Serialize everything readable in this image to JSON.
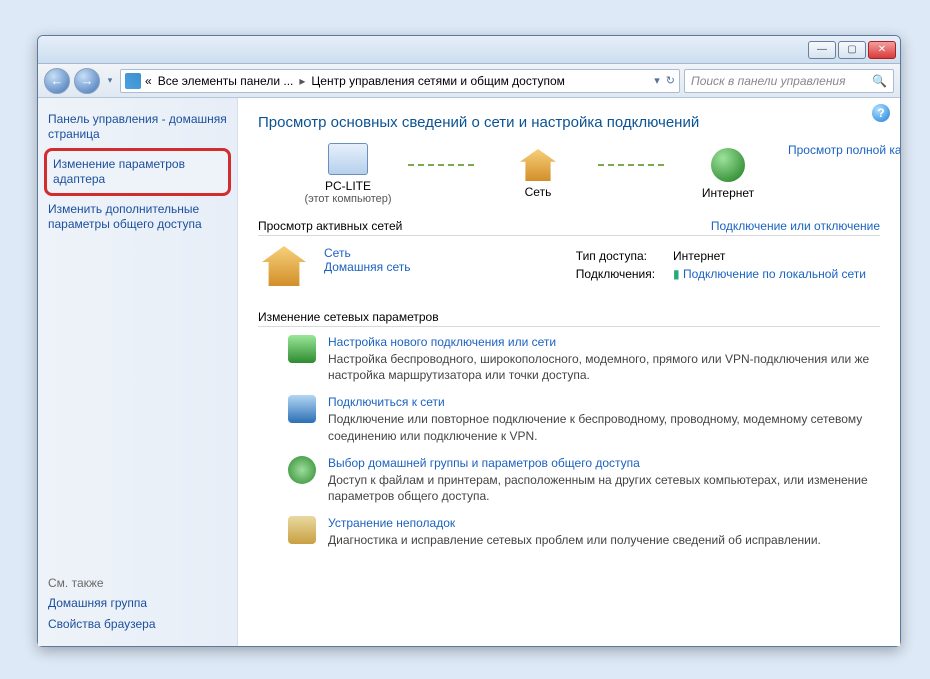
{
  "breadcrumb": {
    "prefix": "«",
    "p1": "Все элементы панели ...",
    "p2": "Центр управления сетями и общим доступом"
  },
  "search": {
    "placeholder": "Поиск в панели управления"
  },
  "sidebar": {
    "header": "Панель управления - домашняя страница",
    "adapter": "Изменение параметров адаптера",
    "sharing": "Изменить дополнительные параметры общего доступа",
    "seeAlso": "См. также",
    "homegroup": "Домашняя группа",
    "browser": "Свойства браузера"
  },
  "main": {
    "title": "Просмотр основных сведений о сети и настройка подключений",
    "fullMap": "Просмотр полной карты",
    "node1": {
      "label": "PC-LITE",
      "sub": "(этот компьютер)"
    },
    "node2": {
      "label": "Сеть"
    },
    "node3": {
      "label": "Интернет"
    },
    "activeTitle": "Просмотр активных сетей",
    "connectToggle": "Подключение или отключение",
    "network": {
      "name": "Сеть",
      "sub": "Домашняя сеть"
    },
    "propAccessLabel": "Тип доступа:",
    "propAccessVal": "Интернет",
    "propConnLabel": "Подключения:",
    "propConnVal": "Подключение по локальной сети",
    "changeTitle": "Изменение сетевых параметров",
    "tasks": [
      {
        "title": "Настройка нового подключения или сети",
        "desc": "Настройка беспроводного, широкополосного, модемного, прямого или VPN-подключения или же настройка маршрутизатора или точки доступа."
      },
      {
        "title": "Подключиться к сети",
        "desc": "Подключение или повторное подключение к беспроводному, проводному, модемному сетевому соединению или подключение к VPN."
      },
      {
        "title": "Выбор домашней группы и параметров общего доступа",
        "desc": "Доступ к файлам и принтерам, расположенным на других сетевых компьютерах, или изменение параметров общего доступа."
      },
      {
        "title": "Устранение неполадок",
        "desc": "Диагностика и исправление сетевых проблем или получение сведений об исправлении."
      }
    ]
  }
}
